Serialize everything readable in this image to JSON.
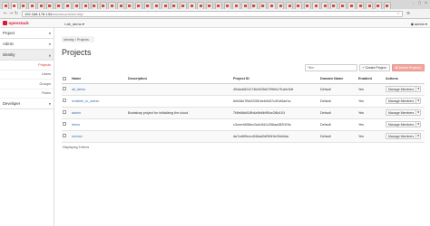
{
  "browser": {
    "tab_count": 44,
    "url_host": "192.168.178.134",
    "url_path": "/dashboard/identity/"
  },
  "app": {
    "logo_text": "openstack",
    "project_selector": "alt_demo",
    "user_menu": "admin"
  },
  "sidebar": {
    "sections": [
      {
        "label": "Project",
        "open": false
      },
      {
        "label": "Admin",
        "open": false
      },
      {
        "label": "Identity",
        "open": true
      }
    ],
    "identity_items": [
      "Projects",
      "Users",
      "Groups",
      "Roles"
    ],
    "active_item": "Projects",
    "bottom_section": "Developer"
  },
  "main": {
    "breadcrumb": [
      "Identity",
      "Projects"
    ],
    "title": "Projects",
    "filter_placeholder": "Filter",
    "create_label": "Create Project",
    "delete_label": "Delete Projects",
    "columns": [
      "Name",
      "Description",
      "Project ID",
      "Domain Name",
      "Enabled",
      "Actions"
    ],
    "rows": [
      {
        "name": "alt_demo",
        "description": "",
        "project_id": "494ac6624174fa303b6799b0c7f1a0c9df",
        "domain": "Default",
        "enabled": "Yes",
        "action": "Manage Members"
      },
      {
        "name": "invisible_to_admin",
        "description": "",
        "project_id": "6d046e7f5d23351beb0d37c4f1d0ae1a",
        "domain": "Default",
        "enabled": "Yes",
        "action": "Manage Members"
      },
      {
        "name": "admin",
        "description": "Bootstrap project for initializing the cloud.",
        "project_id": "7f4fe8db81ffb4a9b6b9f0ce2f8c1f1f",
        "domain": "Default",
        "enabled": "Yes",
        "action": "Manage Members"
      },
      {
        "name": "demo",
        "description": "",
        "project_id": "c3cee4d0f6ec2a4c9d1c256aa382f1f3a",
        "domain": "Default",
        "enabled": "Yes",
        "action": "Manage Members"
      },
      {
        "name": "service",
        "description": "",
        "project_id": "da7cd6f0ecc4f46ad0df9549e2fdd4da",
        "domain": "Default",
        "enabled": "Yes",
        "action": "Manage Members"
      }
    ],
    "footer": "Displaying 5 items"
  }
}
